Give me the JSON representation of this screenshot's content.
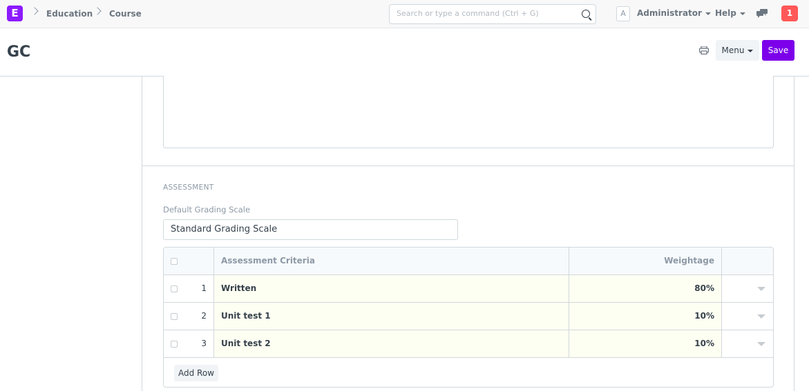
{
  "navbar": {
    "logo_letter": "E",
    "breadcrumbs": [
      "Education",
      "Course"
    ],
    "search_placeholder": "Search or type a command (Ctrl + G)",
    "avatar_letter": "A",
    "user_label": "Administrator",
    "help_label": "Help",
    "notification_count": "1"
  },
  "page": {
    "title": "GC",
    "menu_label": "Menu",
    "save_label": "Save"
  },
  "assessment": {
    "section_title": "ASSESSMENT",
    "grading_scale_label": "Default Grading Scale",
    "grading_scale_value": "Standard Grading Scale",
    "table": {
      "headers": {
        "criteria": "Assessment Criteria",
        "weightage": "Weightage"
      },
      "rows": [
        {
          "idx": "1",
          "criteria": "Written",
          "weightage": "80%"
        },
        {
          "idx": "2",
          "criteria": "Unit test 1",
          "weightage": "10%"
        },
        {
          "idx": "3",
          "criteria": "Unit test 2",
          "weightage": "10%"
        }
      ],
      "add_row_label": "Add Row"
    }
  },
  "colors": {
    "brand": "#8c1bff",
    "primary_button": "#7c00ea",
    "notification": "#ff5858",
    "edited_row_bg": "#fdfff2"
  },
  "icons": [
    "search-icon",
    "chat-icon",
    "print-icon",
    "chevron-right-icon",
    "caret-down-icon"
  ]
}
